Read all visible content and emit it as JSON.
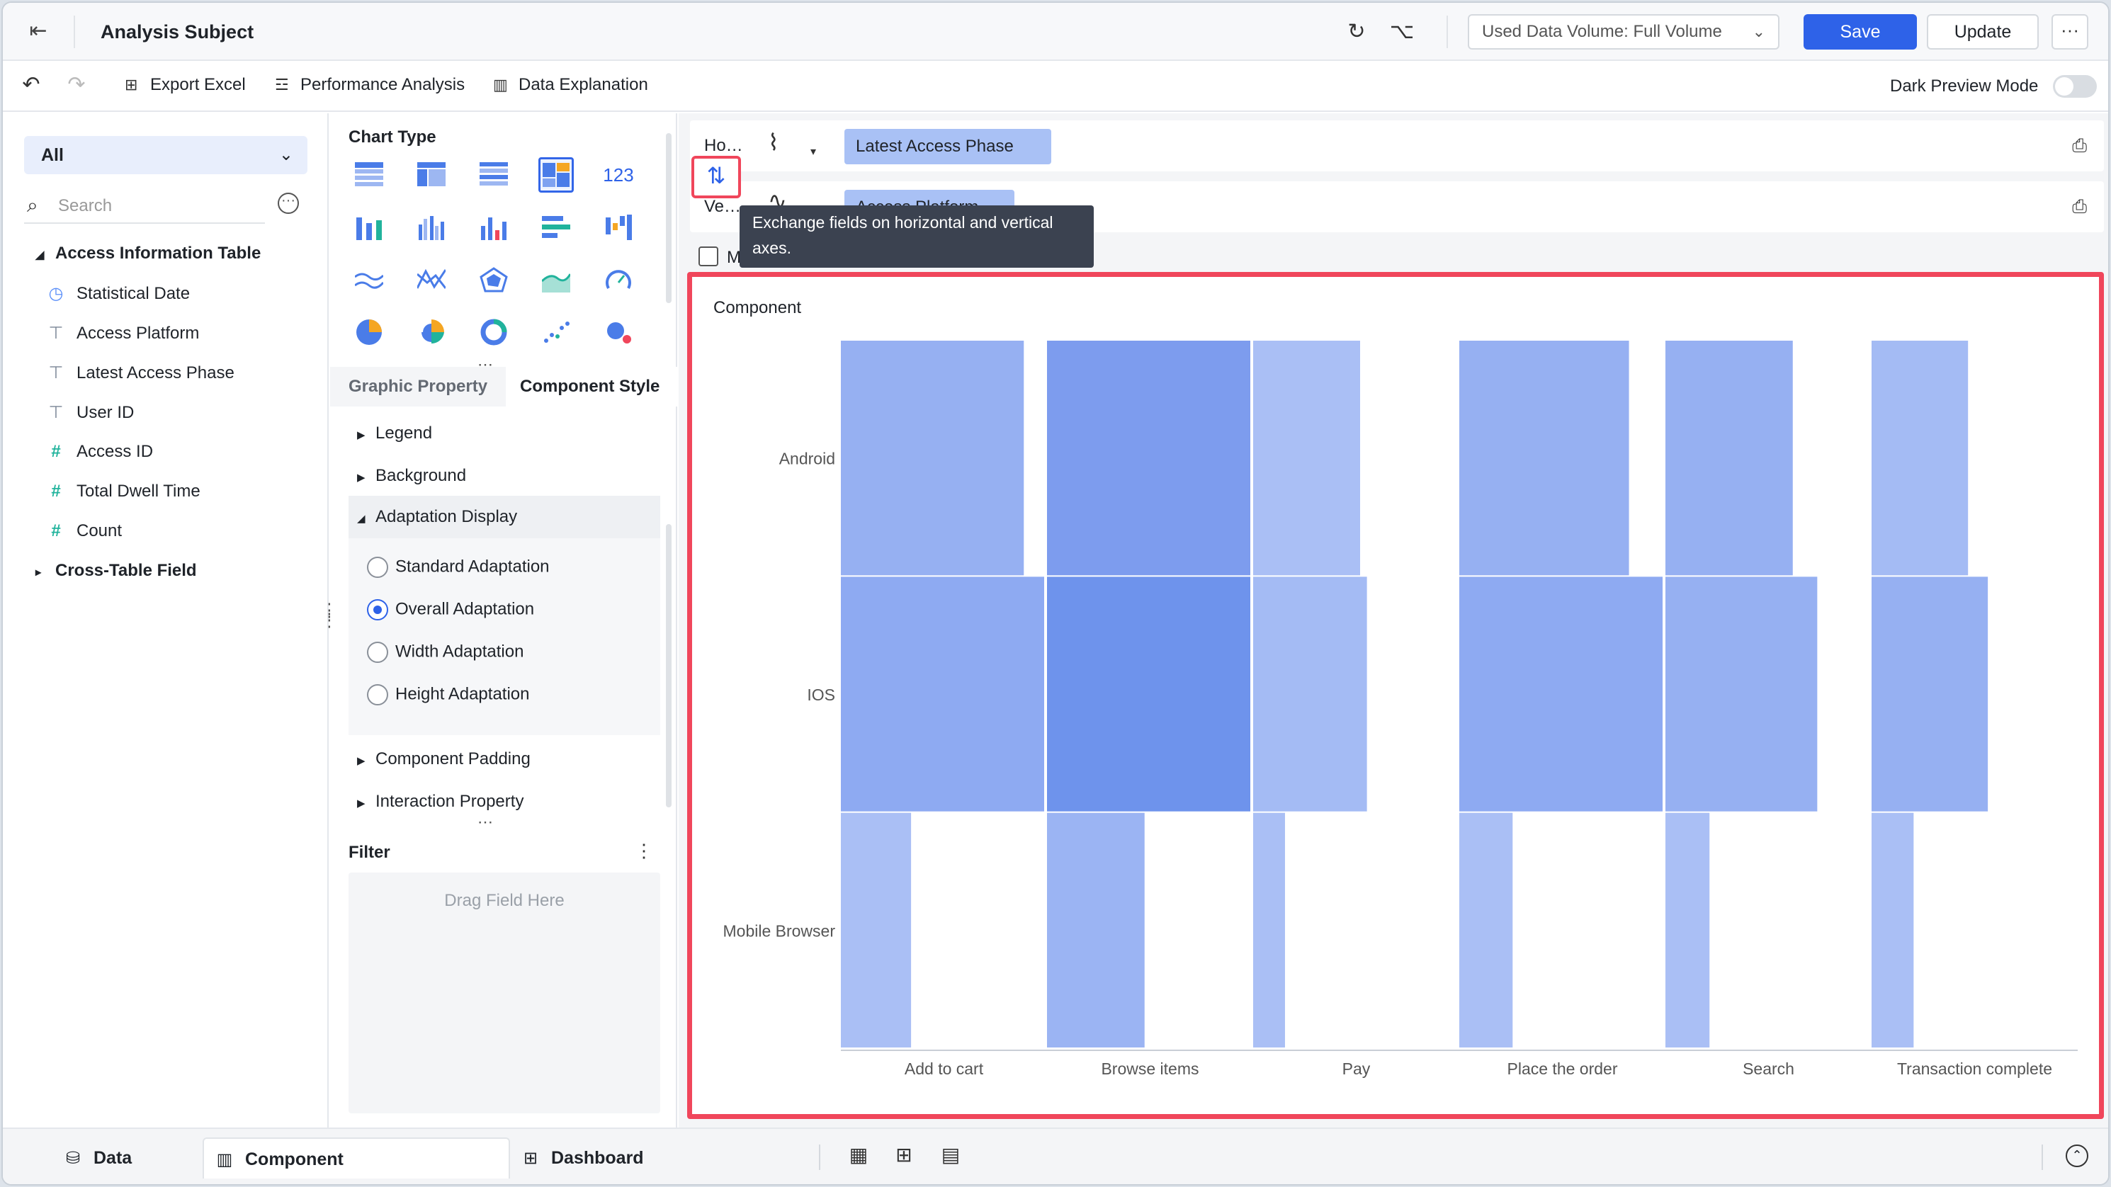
{
  "header": {
    "title": "Analysis Subject",
    "volume_select": "Used Data Volume: Full Volume",
    "save": "Save",
    "update": "Update",
    "more": "···"
  },
  "toolbar": {
    "export_excel": "Export Excel",
    "performance_analysis": "Performance Analysis",
    "data_explanation": "Data Explanation",
    "dark_preview": "Dark Preview Mode",
    "dark_preview_on": false
  },
  "left": {
    "filter_select": "All",
    "search_placeholder": "Search",
    "table_name": "Access Information Table",
    "fields": [
      {
        "label": "Statistical Date",
        "icon": "clock-icon"
      },
      {
        "label": "Access Platform",
        "icon": "text-dimension-icon"
      },
      {
        "label": "Latest Access Phase",
        "icon": "text-dimension-icon"
      },
      {
        "label": "User ID",
        "icon": "text-dimension-icon"
      },
      {
        "label": "Access ID",
        "icon": "measure-icon"
      },
      {
        "label": "Total Dwell Time",
        "icon": "measure-icon"
      },
      {
        "label": "Count",
        "icon": "measure-icon"
      }
    ],
    "cross_table": "Cross-Table Field"
  },
  "middle": {
    "chart_type_title": "Chart Type",
    "tab_graphic": "Graphic Property",
    "tab_component": "Component Style",
    "props": {
      "legend": "Legend",
      "background": "Background",
      "adaptation": "Adaptation Display",
      "padding": "Component Padding",
      "interaction": "Interaction Property"
    },
    "adaptation_options": [
      {
        "label": "Standard Adaptation",
        "selected": false
      },
      {
        "label": "Overall Adaptation",
        "selected": true
      },
      {
        "label": "Width Adaptation",
        "selected": false
      },
      {
        "label": "Height Adaptation",
        "selected": false
      }
    ],
    "filter_title": "Filter",
    "filter_drop": "Drag Field Here",
    "number_glyph": "123"
  },
  "axes": {
    "horizontal_label": "Ho…",
    "vertical_label": "Ve…",
    "horizontal_field": "Latest Access Phase",
    "vertical_field": "Access Platform",
    "tooltip": "Exchange fields on horizontal and vertical axes.",
    "checkbox_label": "M"
  },
  "canvas": {
    "title": "Component"
  },
  "chart_data": {
    "type": "heatmap",
    "title": "",
    "categories": [
      "Add to cart",
      "Browse items",
      "Pay",
      "Place the order",
      "Search",
      "Transaction complete"
    ],
    "rows": [
      "Android",
      "IOS",
      "Mobile Browser"
    ],
    "column_weights": [
      86,
      136,
      46,
      98,
      66,
      50
    ],
    "widths_in_row": [
      [
        0.86,
        0.93,
        0.94,
        0.7,
        0.78,
        0.78
      ],
      [
        1.0,
        1.0,
        1.0,
        0.92,
        0.93,
        0.94
      ],
      [
        0.33,
        0.29,
        0.28,
        0.22,
        0.27,
        0.34
      ]
    ],
    "colors": [
      [
        "#96b0f2",
        "#7d9cee",
        "#aabff5",
        "#96b0f2",
        "#96b0f2",
        "#a4bbf4"
      ],
      [
        "#8eaaf2",
        "#6e93ec",
        "#a4bbf4",
        "#8eaaf2",
        "#96b0f2",
        "#96b0f2"
      ],
      [
        "#aabff5",
        "#9bb4f3",
        "#aabff5",
        "#aabff5",
        "#aabff5",
        "#aabff5"
      ]
    ]
  },
  "bottom": {
    "data_tab": "Data",
    "component_tab": "Component",
    "dashboard_tab": "Dashboard"
  }
}
